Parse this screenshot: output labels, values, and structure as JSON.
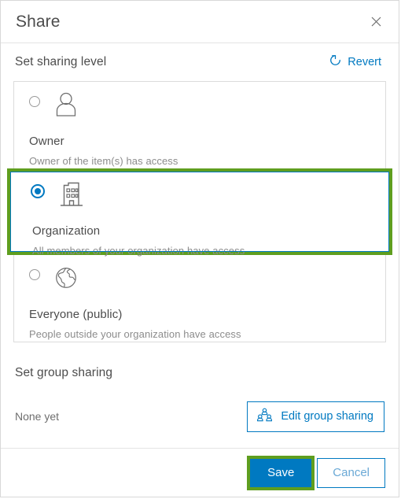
{
  "dialog": {
    "title": "Share",
    "close_icon": "close-x-icon"
  },
  "sharing_level": {
    "section_title": "Set sharing level",
    "revert_label": "Revert",
    "revert_icon": "revert-circular-arrow-icon",
    "options": [
      {
        "label": "Owner",
        "description": "Owner of the item(s) has access",
        "icon": "person-icon",
        "selected": false
      },
      {
        "label": "Organization",
        "description": "All members of your organization have access",
        "icon": "building-icon",
        "selected": true
      },
      {
        "label": "Everyone (public)",
        "description": "People outside your organization have access",
        "icon": "globe-icon",
        "selected": false
      }
    ]
  },
  "group_sharing": {
    "section_title": "Set group sharing",
    "status": "None yet",
    "edit_button_label": "Edit group sharing",
    "edit_button_icon": "group-people-icon"
  },
  "footer": {
    "save_label": "Save",
    "cancel_label": "Cancel"
  },
  "colors": {
    "accent_blue": "#0079c1",
    "highlight_green": "#5f9e1f",
    "text_primary": "#4c4c4c",
    "text_muted": "#8c8c8c",
    "border_gray": "#dcdcdc"
  }
}
